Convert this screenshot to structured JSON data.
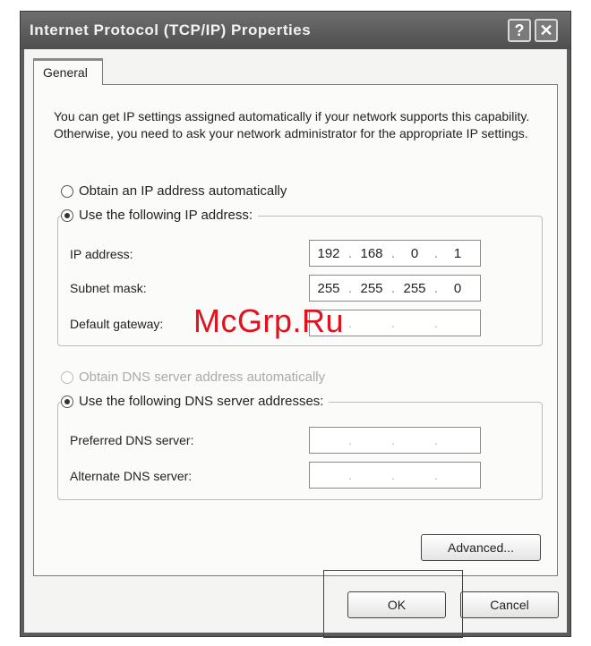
{
  "window": {
    "title": "Internet Protocol (TCP/IP) Properties",
    "help_glyph": "?",
    "close_glyph": "✕"
  },
  "tabs": [
    {
      "label": "General"
    }
  ],
  "intro_text": "You can get IP settings assigned automatically if your network supports this capability. Otherwise, you need to ask your network administrator for the appropriate IP settings.",
  "ip_section": {
    "obtain_auto_label": "Obtain an IP address automatically",
    "use_following_label": "Use the following IP address:",
    "selected": "use_following",
    "fields": [
      {
        "label": "IP address:",
        "octets": [
          "192",
          "168",
          "0",
          "1"
        ]
      },
      {
        "label": "Subnet mask:",
        "octets": [
          "255",
          "255",
          "255",
          "0"
        ]
      },
      {
        "label": "Default gateway:",
        "octets": [
          "",
          "",
          "",
          ""
        ]
      }
    ]
  },
  "dns_section": {
    "obtain_auto_label": "Obtain DNS server address automatically",
    "obtain_auto_enabled": false,
    "use_following_label": "Use the following DNS server addresses:",
    "selected": "use_following",
    "fields": [
      {
        "label": "Preferred DNS server:",
        "octets": [
          "",
          "",
          "",
          ""
        ]
      },
      {
        "label": "Alternate DNS server:",
        "octets": [
          "",
          "",
          "",
          ""
        ]
      }
    ]
  },
  "buttons": {
    "advanced": "Advanced...",
    "ok": "OK",
    "cancel": "Cancel"
  },
  "watermark": "McGrp.Ru",
  "icons": {
    "help": "help-icon",
    "close": "close-icon",
    "radio": "radio-button"
  }
}
